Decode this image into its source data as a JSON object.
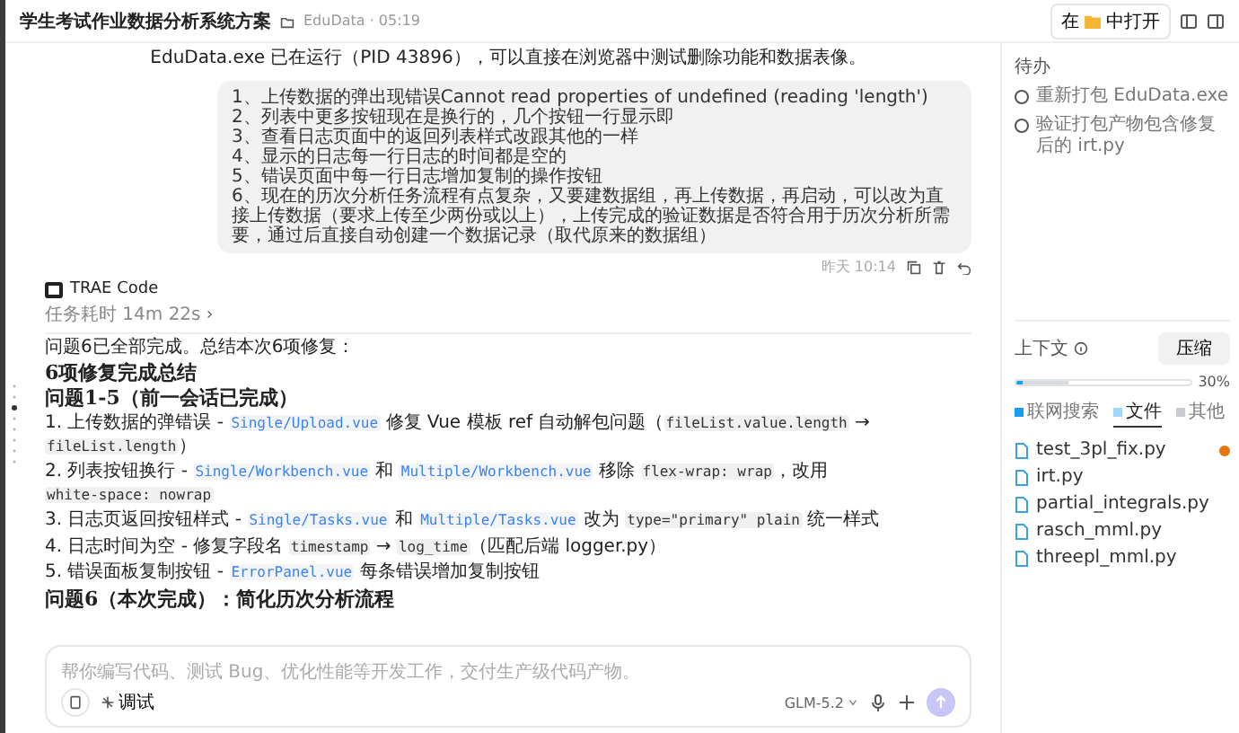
{
  "header": {
    "title": "学生考试作业数据分析系统方案",
    "folder": "EduData · 05:19",
    "open_prefix": "在",
    "open_suffix": "中打开"
  },
  "status_message": "EduData.exe 已在运行（PID 43896），可以直接在浏览器中测试删除功能和数据表像。",
  "user_message": {
    "lines": [
      "1、上传数据的弹出现错误Cannot read properties of undefined (reading 'length')",
      "2、列表中更多按钮现在是换行的，几个按钮一行显示即",
      "3、查看日志页面中的返回列表样式改跟其他的一样",
      "4、显示的日志每一行日志的时间都是空的",
      "5、错误页面中每一行日志增加复制的操作按钮",
      "6、现在的历次分析任务流程有点复杂，又要建数据组，再上传数据，再启动，可以改为直接上传数据（要求上传至少两份或以上），上传完成的验证数据是否符合用于历次分析所需要，通过后直接自动创建一个数据记录（取代原来的数据组）"
    ],
    "time": "昨天 10:14"
  },
  "assistant": {
    "name": "TRAE Code",
    "duration": "任务耗时 14m 22s",
    "blocks": [
      {
        "kind": "paragraph",
        "segments": [
          {
            "kind": "text",
            "text": "问题6已全部完成。总结本次6项修复："
          }
        ]
      },
      {
        "kind": "heading",
        "segments": [
          {
            "kind": "text",
            "text": "6项修复完成总结"
          }
        ]
      },
      {
        "kind": "heading",
        "segments": [
          {
            "kind": "text",
            "text": "问题1-5（前一会话已完成）"
          }
        ]
      },
      {
        "kind": "item",
        "segments": [
          {
            "kind": "text",
            "text": "1. 上传数据的弹错误 - "
          },
          {
            "kind": "link",
            "text": "Single/Upload.vue"
          },
          {
            "kind": "text",
            "text": " 修复 Vue 模板 ref 自动解包问题（"
          },
          {
            "kind": "code",
            "text": "fileList.value.length"
          },
          {
            "kind": "text",
            "text": " → "
          },
          {
            "kind": "code",
            "text": "fileList.length"
          },
          {
            "kind": "text",
            "text": "）"
          }
        ]
      },
      {
        "kind": "item",
        "segments": [
          {
            "kind": "text",
            "text": "2. 列表按钮换行 - "
          },
          {
            "kind": "link",
            "text": "Single/Workbench.vue"
          },
          {
            "kind": "text",
            "text": " 和 "
          },
          {
            "kind": "link",
            "text": "Multiple/Workbench.vue"
          },
          {
            "kind": "text",
            "text": " 移除 "
          },
          {
            "kind": "code",
            "text": "flex-wrap: wrap"
          },
          {
            "kind": "text",
            "text": "，改用 "
          },
          {
            "kind": "code",
            "text": "white-space: nowrap"
          }
        ]
      },
      {
        "kind": "item",
        "segments": [
          {
            "kind": "text",
            "text": "3. 日志页返回按钮样式 - "
          },
          {
            "kind": "link",
            "text": "Single/Tasks.vue"
          },
          {
            "kind": "text",
            "text": " 和 "
          },
          {
            "kind": "link",
            "text": "Multiple/Tasks.vue"
          },
          {
            "kind": "text",
            "text": " 改为 "
          },
          {
            "kind": "code",
            "text": "type=\"primary\" plain"
          },
          {
            "kind": "text",
            "text": " 统一样式"
          }
        ]
      },
      {
        "kind": "item",
        "segments": [
          {
            "kind": "text",
            "text": "4. 日志时间为空 - 修复字段名 "
          },
          {
            "kind": "code",
            "text": "timestamp"
          },
          {
            "kind": "text",
            "text": " → "
          },
          {
            "kind": "code",
            "text": "log_time"
          },
          {
            "kind": "text",
            "text": "（匹配后端 logger.py）"
          }
        ]
      },
      {
        "kind": "item",
        "segments": [
          {
            "kind": "text",
            "text": "5. 错误面板复制按钮 - "
          },
          {
            "kind": "link",
            "text": "ErrorPanel.vue"
          },
          {
            "kind": "text",
            "text": " 每条错误增加复制按钮"
          }
        ]
      },
      {
        "kind": "heading",
        "segments": [
          {
            "kind": "text",
            "text": "问题6（本次完成）：简化历次分析流程"
          }
        ]
      }
    ]
  },
  "composer": {
    "placeholder": "帮你编写代码、测试 Bug、优化性能等开发工作，交付生产级代码产物。",
    "mode": "调试",
    "model": "GLM-5.2"
  },
  "todo": {
    "title": "待办",
    "items": [
      {
        "text": "重新打包 EduData.exe",
        "checked": false
      },
      {
        "text": "验证打包产物包含修复后的 irt.py",
        "checked": false
      }
    ]
  },
  "context": {
    "title": "上下文",
    "compress": "压缩",
    "level": 0.3,
    "percent": "30%",
    "tabs": [
      {
        "label": "联网搜索",
        "selected": false,
        "color": "#1a9cf0"
      },
      {
        "label": "文件",
        "selected": true,
        "color": "#9fd8fb"
      },
      {
        "label": "其他",
        "selected": false,
        "color": "#c9ccd3"
      }
    ],
    "files": [
      {
        "name": "test_3pl_fix.py",
        "modified": true
      },
      {
        "name": "irt.py",
        "modified": false
      },
      {
        "name": "partial_integrals.py",
        "modified": false
      },
      {
        "name": "rasch_mml.py",
        "modified": false
      },
      {
        "name": "threepl_mml.py",
        "modified": false
      }
    ]
  }
}
